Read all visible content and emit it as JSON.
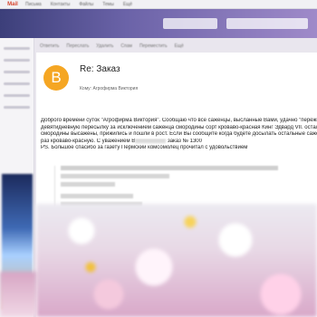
{
  "topbar": {
    "logo": "Mail",
    "nav": [
      "Письма",
      "Контакты",
      "Файлы",
      "Темы",
      "Ещё"
    ]
  },
  "toolbar": {
    "items": [
      "Ответить",
      "Переслать",
      "Удалить",
      "Спам",
      "Переместить",
      "Ещё"
    ]
  },
  "message": {
    "avatar_letter": "B",
    "subject": "Re: Заказ",
    "from": "",
    "to": "Кому: Агрофирма Виктория",
    "date": "",
    "body_lines": [
      "Доброго времени суток \"Агрофирма Виктория\". Сообщаю что все саженцы, высланные Вами, удачно \"пережил",
      "девятидневную пересылку за исключением саженца смородины сорт кроваво-красная Кинг Эдвард VII. остальн",
      "смородины высажены, прижились и пошли в рост. Если Вы сообщите когда будете досылать остальные саженц",
      "раз кроваво-красную. С уважением В",
      "заказ № 1300",
      "PS. Большое спасибо за газету Пермский комсомолец прочитал с удовольствием"
    ]
  },
  "colors": {
    "header_start": "#3c3f7a",
    "header_end": "#9f8ac9",
    "avatar_bg": "#f5a623"
  }
}
